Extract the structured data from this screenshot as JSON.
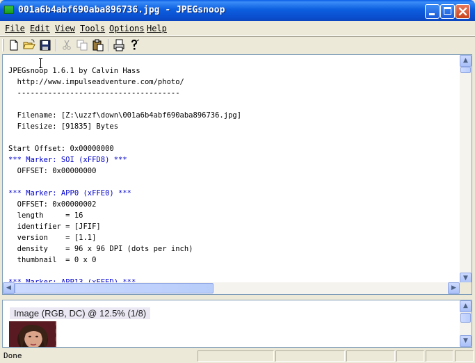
{
  "window": {
    "title": "001a6b4abf690aba896736.jpg - JPEGsnoop"
  },
  "menu": [
    "File",
    "Edit",
    "View",
    "Tools",
    "Options",
    "Help"
  ],
  "toolbar": {
    "buttons": [
      "new-file-icon",
      "open-folder-icon",
      "save-disk-icon",
      "cut-icon",
      "copy-icon",
      "paste-icon",
      "print-icon",
      "help-icon"
    ]
  },
  "report": {
    "lines": [
      {
        "text": "JPEGsnoop 1.6.1 by Calvin Hass",
        "marker": false
      },
      {
        "text": "  http://www.impulseadventure.com/photo/",
        "marker": false
      },
      {
        "text": "  -------------------------------------",
        "marker": false
      },
      {
        "text": "",
        "marker": false
      },
      {
        "text": "  Filename: [Z:\\uzzf\\down\\001a6b4abf690aba896736.jpg]",
        "marker": false
      },
      {
        "text": "  Filesize: [91835] Bytes",
        "marker": false
      },
      {
        "text": "",
        "marker": false
      },
      {
        "text": "Start Offset: 0x00000000",
        "marker": false
      },
      {
        "text": "*** Marker: SOI (xFFD8) ***",
        "marker": true
      },
      {
        "text": "  OFFSET: 0x00000000",
        "marker": false
      },
      {
        "text": "",
        "marker": false
      },
      {
        "text": "*** Marker: APP0 (xFFE0) ***",
        "marker": true
      },
      {
        "text": "  OFFSET: 0x00000002",
        "marker": false
      },
      {
        "text": "  length     = 16",
        "marker": false
      },
      {
        "text": "  identifier = [JFIF]",
        "marker": false
      },
      {
        "text": "  version    = [1.1]",
        "marker": false
      },
      {
        "text": "  density    = 96 x 96 DPI (dots per inch)",
        "marker": false
      },
      {
        "text": "  thumbnail  = 0 x 0",
        "marker": false
      },
      {
        "text": "",
        "marker": false
      },
      {
        "text": "*** Marker: APP13 (xFFED) ***",
        "marker": true
      }
    ]
  },
  "image_pane": {
    "caption": "Image (RGB, DC) @ 12.5% (1/8)"
  },
  "status": {
    "text": "Done"
  },
  "colors": {
    "marker_text": "#0000cc",
    "title_bar": "#0a5fe6",
    "window_bg": "#ece9d8"
  }
}
